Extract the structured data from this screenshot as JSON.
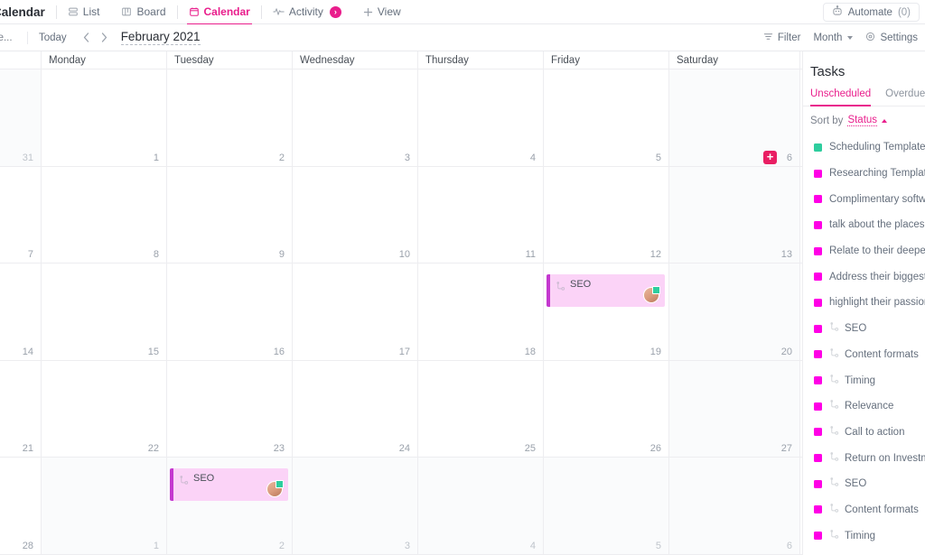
{
  "view_bar": {
    "title": "Calendar",
    "tabs": [
      {
        "label": "List",
        "icon": "list-icon",
        "active": false
      },
      {
        "label": "Board",
        "icon": "board-icon",
        "active": false
      },
      {
        "label": "Calendar",
        "icon": "calendar-icon",
        "active": true
      },
      {
        "label": "Activity",
        "icon": "activity-icon",
        "active": false,
        "badge": "›"
      },
      {
        "label": "View",
        "icon": "plus-icon",
        "active": false
      }
    ],
    "automate": {
      "label": "Automate",
      "count": "(0)",
      "icon": "robot-icon"
    }
  },
  "tool_bar": {
    "left_truncated": "me...",
    "today_label": "Today",
    "prev_icon": "chevron-left-icon",
    "next_icon": "chevron-right-icon",
    "month_title": "February 2021",
    "filter_label": "Filter",
    "range_label": "Month",
    "settings_label": "Settings"
  },
  "calendar": {
    "weekdays": [
      "",
      "Monday",
      "Tuesday",
      "Wednesday",
      "Thursday",
      "Friday",
      "Saturday"
    ],
    "add_button_label": "+",
    "weeks": [
      [
        {
          "day": "31",
          "other_month": true,
          "tinted": false
        },
        {
          "day": "1",
          "other_month": false,
          "tinted": false
        },
        {
          "day": "2",
          "other_month": false,
          "tinted": false
        },
        {
          "day": "3",
          "other_month": false,
          "tinted": false
        },
        {
          "day": "4",
          "other_month": false,
          "tinted": false
        },
        {
          "day": "5",
          "other_month": false,
          "tinted": false
        },
        {
          "day": "6",
          "other_month": false,
          "tinted": true,
          "show_add": true
        }
      ],
      [
        {
          "day": "7",
          "other_month": false,
          "tinted": false
        },
        {
          "day": "8",
          "other_month": false,
          "tinted": false
        },
        {
          "day": "9",
          "other_month": false,
          "tinted": false
        },
        {
          "day": "10",
          "other_month": false,
          "tinted": false
        },
        {
          "day": "11",
          "other_month": false,
          "tinted": false
        },
        {
          "day": "12",
          "other_month": false,
          "tinted": false
        },
        {
          "day": "13",
          "other_month": false,
          "tinted": true
        }
      ],
      [
        {
          "day": "14",
          "other_month": false,
          "tinted": false
        },
        {
          "day": "15",
          "other_month": false,
          "tinted": false
        },
        {
          "day": "16",
          "other_month": false,
          "tinted": false
        },
        {
          "day": "17",
          "other_month": false,
          "tinted": false
        },
        {
          "day": "18",
          "other_month": false,
          "tinted": false
        },
        {
          "day": "19",
          "other_month": false,
          "tinted": false
        },
        {
          "day": "20",
          "other_month": false,
          "tinted": true
        }
      ],
      [
        {
          "day": "21",
          "other_month": false,
          "tinted": false
        },
        {
          "day": "22",
          "other_month": false,
          "tinted": false
        },
        {
          "day": "23",
          "other_month": false,
          "tinted": false
        },
        {
          "day": "24",
          "other_month": false,
          "tinted": false
        },
        {
          "day": "25",
          "other_month": false,
          "tinted": false
        },
        {
          "day": "26",
          "other_month": false,
          "tinted": false
        },
        {
          "day": "27",
          "other_month": false,
          "tinted": true
        }
      ],
      [
        {
          "day": "28",
          "other_month": false,
          "tinted": false
        },
        {
          "day": "1",
          "other_month": true,
          "tinted": false
        },
        {
          "day": "2",
          "other_month": true,
          "tinted": false
        },
        {
          "day": "3",
          "other_month": true,
          "tinted": false
        },
        {
          "day": "4",
          "other_month": true,
          "tinted": false
        },
        {
          "day": "5",
          "other_month": true,
          "tinted": false
        },
        {
          "day": "6",
          "other_month": true,
          "tinted": true
        }
      ]
    ],
    "events": [
      {
        "label": "SEO",
        "week": 2,
        "col": 5,
        "color": "#fbd3f7",
        "accent": "#c438cf",
        "assignee_status": "#2ecd9e"
      },
      {
        "label": "SEO",
        "week": 4,
        "col": 2,
        "color": "#fbd3f7",
        "accent": "#c438cf",
        "assignee_status": "#2ecd9e"
      }
    ]
  },
  "tasks_panel": {
    "title": "Tasks",
    "tabs": [
      {
        "label": "Unscheduled",
        "active": true
      },
      {
        "label": "Overdue",
        "active": false
      }
    ],
    "sort_prefix": "Sort by",
    "sort_field": "Status",
    "sort_direction": "ascending",
    "items": [
      {
        "label": "Scheduling Template",
        "dot": "#2ecd9e",
        "subtask": false
      },
      {
        "label": "Researching Template",
        "dot": "#ff00e6",
        "subtask": false
      },
      {
        "label": "Complimentary software",
        "dot": "#ff00e6",
        "subtask": false
      },
      {
        "label": "talk about the places",
        "dot": "#ff00e6",
        "subtask": false
      },
      {
        "label": "Relate to their deepest",
        "dot": "#ff00e6",
        "subtask": false
      },
      {
        "label": "Address their biggest",
        "dot": "#ff00e6",
        "subtask": false
      },
      {
        "label": "highlight their passion",
        "dot": "#ff00e6",
        "subtask": false
      },
      {
        "label": "SEO",
        "dot": "#ff00e6",
        "subtask": true
      },
      {
        "label": "Content formats",
        "dot": "#ff00e6",
        "subtask": true
      },
      {
        "label": "Timing",
        "dot": "#ff00e6",
        "subtask": true
      },
      {
        "label": "Relevance",
        "dot": "#ff00e6",
        "subtask": true
      },
      {
        "label": "Call to action",
        "dot": "#ff00e6",
        "subtask": true
      },
      {
        "label": "Return on Investment",
        "dot": "#ff00e6",
        "subtask": true
      },
      {
        "label": "SEO",
        "dot": "#ff00e6",
        "subtask": true
      },
      {
        "label": "Content formats",
        "dot": "#ff00e6",
        "subtask": true
      },
      {
        "label": "Timing",
        "dot": "#ff00e6",
        "subtask": true
      }
    ]
  },
  "colors": {
    "accent_pink": "#e91e8c",
    "add_pink": "#e91e63",
    "event_bg": "#fbd3f7",
    "event_accent": "#c438cf",
    "status_green": "#2ecd9e",
    "status_magenta": "#ff00e6"
  }
}
